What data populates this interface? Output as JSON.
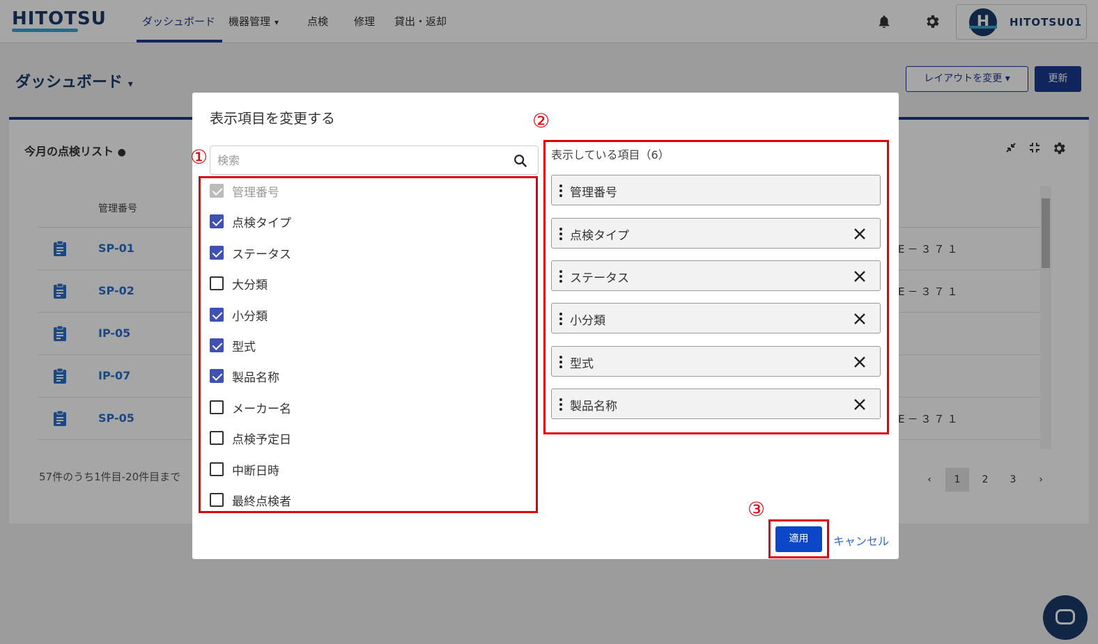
{
  "header": {
    "logo": "HITOTSU",
    "nav": [
      {
        "label": "ダッシュボード",
        "active": true
      },
      {
        "label": "機器管理",
        "dropdown": true
      },
      {
        "label": "点検"
      },
      {
        "label": "修理"
      },
      {
        "label": "貸出・返却"
      }
    ],
    "user": {
      "initial": "H",
      "name": "HITOTSU01"
    }
  },
  "page": {
    "title": "ダッシュボード",
    "layout_button": "レイアウトを変更",
    "refresh_button": "更新"
  },
  "card": {
    "title": "今月の点検リスト",
    "column_header": "管理番号",
    "rows": [
      {
        "id": "SP-01",
        "tail": "E－３７１"
      },
      {
        "id": "SP-02",
        "tail": "E－３７１"
      },
      {
        "id": "IP-05",
        "tail": ""
      },
      {
        "id": "IP-07",
        "tail": ""
      },
      {
        "id": "SP-05",
        "tail": "E－３７１"
      }
    ],
    "count_text": "57件のうち1件目-20件目まで",
    "pages": [
      "‹",
      "1",
      "2",
      "3",
      "›"
    ],
    "current_page": "1"
  },
  "modal": {
    "title": "表示項目を変更する",
    "search_placeholder": "検索",
    "options": [
      {
        "label": "管理番号",
        "state": "disabled"
      },
      {
        "label": "点検タイプ",
        "state": "checked"
      },
      {
        "label": "ステータス",
        "state": "checked"
      },
      {
        "label": "大分類",
        "state": "unchecked"
      },
      {
        "label": "小分類",
        "state": "checked"
      },
      {
        "label": "型式",
        "state": "checked"
      },
      {
        "label": "製品名称",
        "state": "checked"
      },
      {
        "label": "メーカー名",
        "state": "unchecked"
      },
      {
        "label": "点検予定日",
        "state": "unchecked"
      },
      {
        "label": "中断日時",
        "state": "unchecked"
      },
      {
        "label": "最終点検者",
        "state": "unchecked"
      }
    ],
    "shown_title": "表示している項目（6）",
    "shown_items": [
      {
        "label": "管理番号",
        "removable": false
      },
      {
        "label": "点検タイプ",
        "removable": true
      },
      {
        "label": "ステータス",
        "removable": true
      },
      {
        "label": "小分類",
        "removable": true
      },
      {
        "label": "型式",
        "removable": true
      },
      {
        "label": "製品名称",
        "removable": true
      }
    ],
    "apply_button": "適用",
    "cancel_button": "キャンセル"
  },
  "callouts": [
    "①",
    "②",
    "③"
  ],
  "colors": {
    "primary": "#1b3a8f",
    "accent": "#3da3d8",
    "link": "#2a6fc9",
    "callout": "#e0000b",
    "checkbox": "#3f51b5"
  }
}
